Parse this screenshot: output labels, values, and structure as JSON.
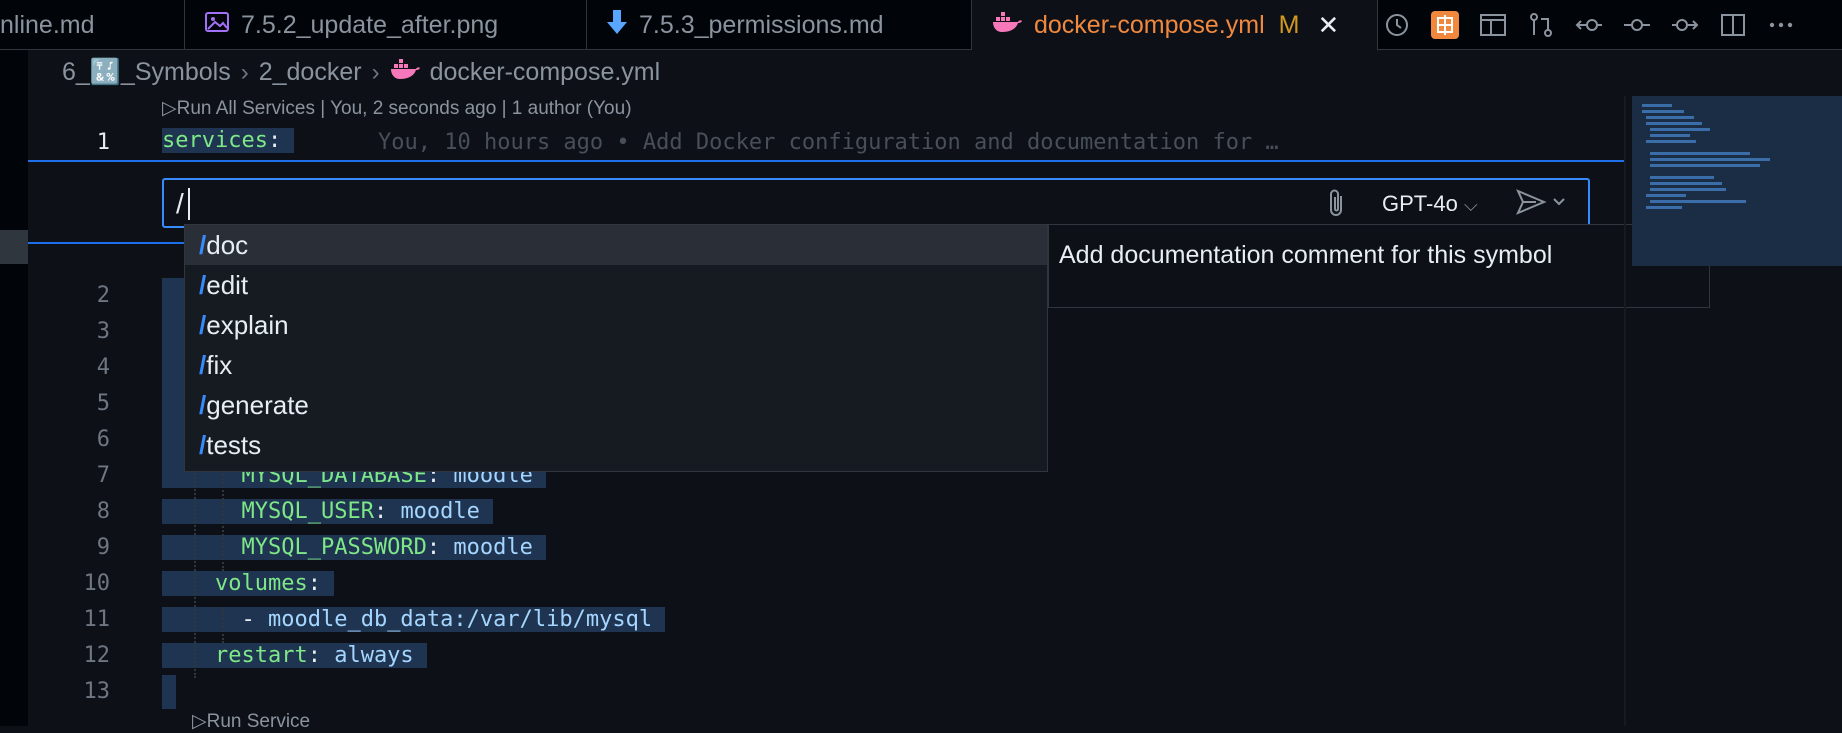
{
  "tabs": [
    {
      "label": "nline.md",
      "icon": "markdown-icon",
      "active": false
    },
    {
      "label": "7.5.2_update_after.png",
      "icon": "image-icon",
      "active": false
    },
    {
      "label": "7.5.3_permissions.md",
      "icon": "download-arrow-icon",
      "active": false
    },
    {
      "label": "docker-compose.yml",
      "icon": "docker-whale-icon",
      "active": true,
      "modified": "M"
    }
  ],
  "breadcrumb": {
    "folder1": "6_🔣_Symbols",
    "folder2": "2_docker",
    "file": "docker-compose.yml"
  },
  "codelens": {
    "top": "▷Run All Services | You, 2 seconds ago | 1 author (You)",
    "bottom": "▷Run Service"
  },
  "editor": {
    "line1": {
      "number": "1",
      "key": "services",
      "colon": ":",
      "blame": "You, 10 hours ago • Add Docker configuration and documentation for …"
    },
    "lines": [
      {
        "number": "2",
        "indent": "",
        "key": "",
        "sep": "",
        "value": ""
      },
      {
        "number": "3",
        "indent": "",
        "key": "",
        "sep": "",
        "value": ""
      },
      {
        "number": "4",
        "indent": "",
        "key": "",
        "sep": "",
        "value": ""
      },
      {
        "number": "5",
        "indent": "",
        "key": "",
        "sep": "",
        "value": ""
      },
      {
        "number": "6",
        "indent": "",
        "key": "",
        "sep": "",
        "value": ""
      },
      {
        "number": "7",
        "indent": "      ",
        "key": "MYSQL_DATABASE",
        "sep": ": ",
        "value": "moodle"
      },
      {
        "number": "8",
        "indent": "      ",
        "key": "MYSQL_USER",
        "sep": ": ",
        "value": "moodle"
      },
      {
        "number": "9",
        "indent": "      ",
        "key": "MYSQL_PASSWORD",
        "sep": ": ",
        "value": "moodle"
      },
      {
        "number": "10",
        "indent": "    ",
        "key": "volumes",
        "sep": ":",
        "value": ""
      },
      {
        "number": "11",
        "indent": "      ",
        "key": "",
        "sep": "- ",
        "value": "moodle_db_data:/var/lib/mysql"
      },
      {
        "number": "12",
        "indent": "    ",
        "key": "restart",
        "sep": ": ",
        "value": "always"
      },
      {
        "number": "13",
        "indent": "",
        "key": "",
        "sep": "",
        "value": ""
      }
    ]
  },
  "chat": {
    "input_value": "/",
    "model": "GPT-4o",
    "model_chevron": "⌵"
  },
  "suggestions": [
    {
      "slash": "/",
      "name": "doc",
      "active": true
    },
    {
      "slash": "/",
      "name": "edit",
      "active": false
    },
    {
      "slash": "/",
      "name": "explain",
      "active": false
    },
    {
      "slash": "/",
      "name": "fix",
      "active": false
    },
    {
      "slash": "/",
      "name": "generate",
      "active": false
    },
    {
      "slash": "/",
      "name": "tests",
      "active": false
    }
  ],
  "doc_panel": {
    "text": "Add documentation comment for this symbol"
  },
  "colors": {
    "accent": "#388bfd",
    "active_tab": "#f0883e",
    "yaml_key": "#7ee787",
    "yaml_value": "#a5d6ff"
  }
}
